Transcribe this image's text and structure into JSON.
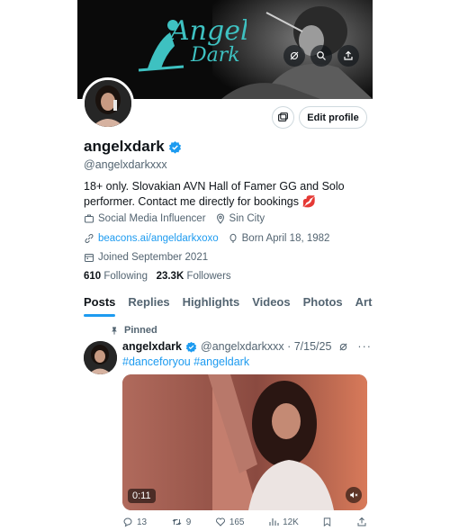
{
  "banner": {
    "logo_text": "Angel Dark"
  },
  "profile": {
    "edit_label": "Edit profile",
    "name": "angelxdark",
    "handle": "@angelxdarkxxx",
    "bio": "18+ only. Slovakian AVN Hall of Famer GG and Solo performer. Contact me directly for bookings 💋",
    "category": "Social Media Influencer",
    "location": "Sin City",
    "link": "beacons.ai/angeldarkxoxo",
    "born": "Born April 18, 1982",
    "joined": "Joined September 2021",
    "following_count": "610",
    "following_label": "Following",
    "followers_count": "23.3K",
    "followers_label": "Followers"
  },
  "tabs": [
    "Posts",
    "Replies",
    "Highlights",
    "Videos",
    "Photos",
    "Arti"
  ],
  "post": {
    "pinned_label": "Pinned",
    "name": "angelxdark",
    "handle_date": "@angelxdarkxxx · 7/15/25",
    "hashtags": "#danceforyou #angeldark",
    "video_duration": "0:11",
    "replies": "13",
    "reposts": "9",
    "likes": "165",
    "views": "12K"
  },
  "colors": {
    "accent": "#1d9bf0",
    "logo": "#3ec1c1"
  },
  "icons": [
    "video-off-icon",
    "search-icon",
    "share-icon",
    "messages-icon",
    "verified-icon",
    "briefcase-icon",
    "location-icon",
    "link-icon",
    "balloon-icon",
    "calendar-icon",
    "pin-icon",
    "more-icon",
    "mute-icon",
    "reply-icon",
    "repost-icon",
    "like-icon",
    "views-icon",
    "bookmark-icon"
  ]
}
